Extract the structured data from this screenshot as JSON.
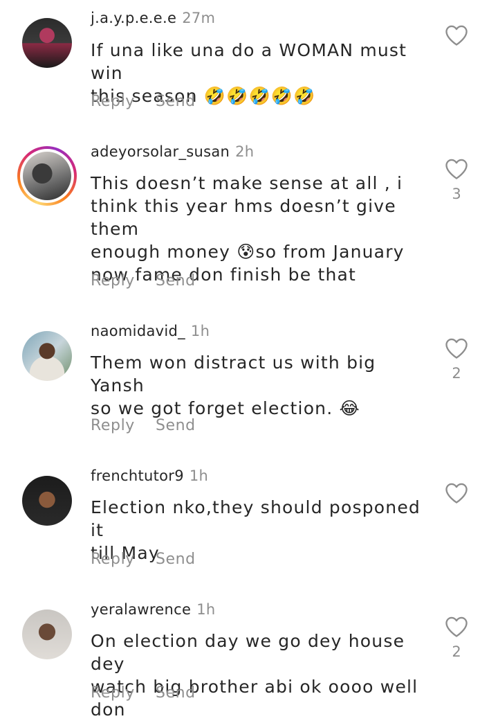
{
  "comments": [
    {
      "username": "j.a.y.p.e.e.e",
      "time": "27m",
      "text_lines": [
        "If una like una do a WOMAN must win",
        "this season 🤣🤣🤣🤣🤣"
      ],
      "likes": "",
      "reply_label": "Reply",
      "send_label": "Send",
      "has_story_ring": false
    },
    {
      "username": "adeyorsolar_susan",
      "time": "2h",
      "text_lines": [
        "This doesn’t make sense at all , i",
        "think this year hms doesn’t give them",
        "enough money 😰so from January",
        "now fame don finish be that"
      ],
      "likes": "3",
      "reply_label": "Reply",
      "send_label": "Send",
      "has_story_ring": true
    },
    {
      "username": "naomidavid_",
      "time": "1h",
      "text_lines": [
        "Them won distract us with big Yansh",
        "so we got forget election. 😂"
      ],
      "likes": "2",
      "reply_label": "Reply",
      "send_label": "Send",
      "has_story_ring": false
    },
    {
      "username": "frenchtutor9",
      "time": "1h",
      "text_lines": [
        "Election nko,they should posponed it",
        "till May"
      ],
      "likes": "",
      "reply_label": "Reply",
      "send_label": "Send",
      "has_story_ring": false
    },
    {
      "username": "yeralawrence",
      "time": "1h",
      "text_lines": [
        "On election day we go dey house dey",
        "watch big brother abi ok oooo well don"
      ],
      "likes": "2",
      "reply_label": "Reply",
      "send_label": "Send",
      "has_story_ring": false
    }
  ],
  "icons": {
    "like": "heart-outline-icon"
  },
  "colors": {
    "text": "#262626",
    "secondary": "#8e8e8e",
    "background": "#ffffff"
  }
}
